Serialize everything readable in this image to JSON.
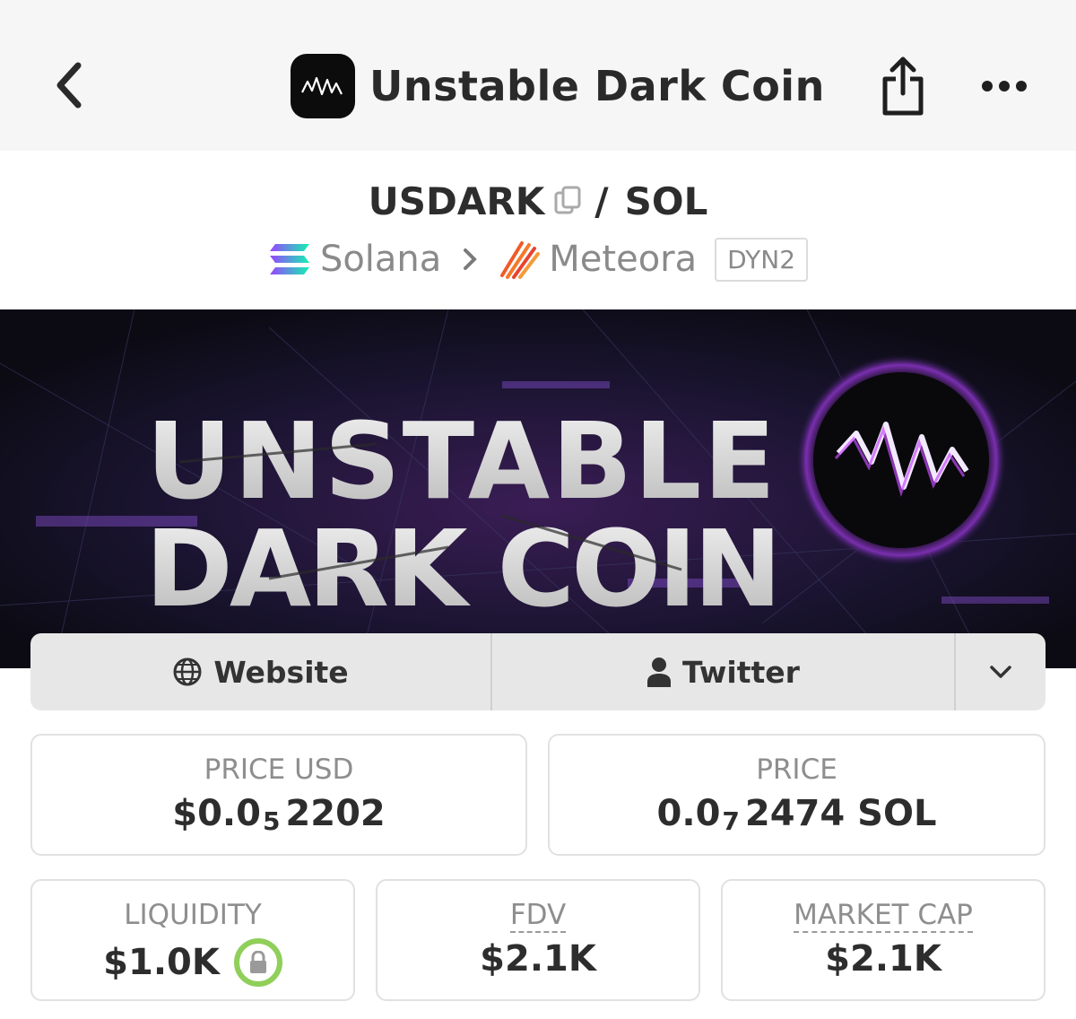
{
  "header": {
    "title": "Unstable Dark Coin",
    "back_icon": "chevron-left-icon",
    "share_icon": "share-icon",
    "more_icon": "more-dots-icon"
  },
  "pair": {
    "base": "USDARK",
    "separator": "/",
    "quote": "SOL"
  },
  "chain": {
    "network": "Solana",
    "dex": "Meteora",
    "badge": "DYN2"
  },
  "banner": {
    "line1": "UNSTABLE",
    "line2": "DARK COIN"
  },
  "links": {
    "website": "Website",
    "twitter": "Twitter"
  },
  "stats": {
    "price_usd": {
      "label": "PRICE USD",
      "prefix": "$0.0",
      "zeros": "5",
      "digits": "2202"
    },
    "price": {
      "label": "PRICE",
      "prefix": "0.0",
      "zeros": "7",
      "digits": "2474 SOL"
    },
    "liquidity": {
      "label": "LIQUIDITY",
      "value": "$1.0K"
    },
    "fdv": {
      "label": "FDV",
      "value": "$2.1K"
    },
    "market_cap": {
      "label": "MARKET CAP",
      "value": "$2.1K"
    }
  },
  "colors": {
    "lock_ring": "#8fcf5a",
    "banner_purple": "#b048e8"
  }
}
